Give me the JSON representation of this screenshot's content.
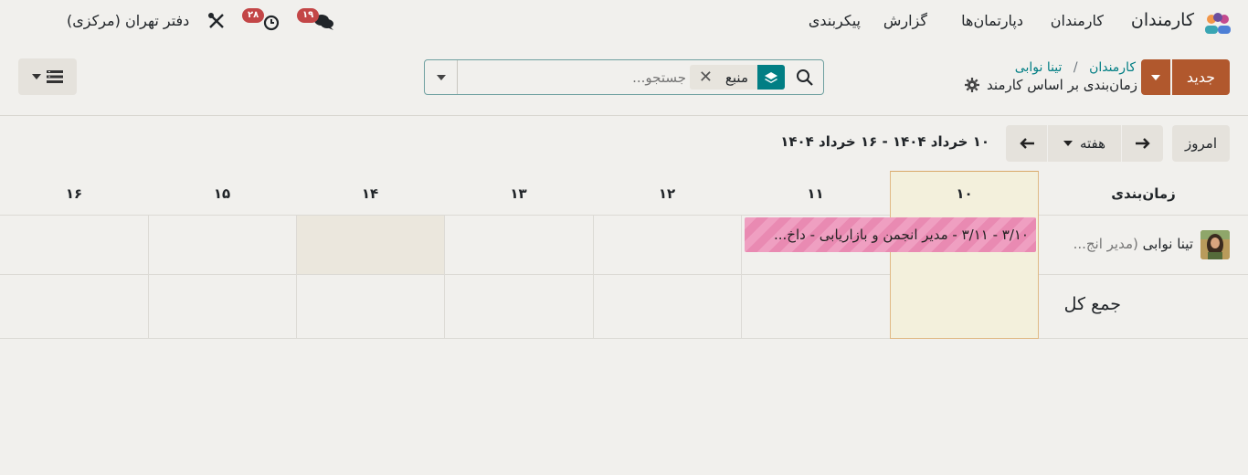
{
  "navbar": {
    "app_name": "کارمندان",
    "menu": [
      "کارمندان",
      "دپارتمان‌ها",
      "گزارش",
      "پیکربندی"
    ],
    "company": "دفتر تهران (مرکزی)",
    "messages_count": "۱۹",
    "activities_count": "۲۸"
  },
  "control_panel": {
    "new_label": "جدید",
    "breadcrumb": [
      "کارمندان",
      "تینا نوابی"
    ],
    "breadcrumb_sep": "/",
    "view_title": "زمان‌بندی بر اساس کارمند",
    "search_placeholder": "جستجو...",
    "facet_label": "منبع"
  },
  "calendar": {
    "today_label": "امروز",
    "scale_label": "هفته",
    "date_range": "۱۰ خرداد ۱۴۰۴ - ۱۶ خرداد ۱۴۰۴",
    "row_header_title": "زمان‌بندی",
    "days": [
      "۱۰",
      "۱۱",
      "۱۲",
      "۱۳",
      "۱۴",
      "۱۵",
      "۱۶"
    ],
    "rows": [
      {
        "name": "تینا نوابی",
        "subtitle": "(مدیر انج...",
        "slot_text": "۳/۱۰ - ۳/۱۱ - مدیر انجمن و بازاریابی - داخ..."
      }
    ],
    "total_label": "جمع کل"
  },
  "colors": {
    "brand": "#b1582d",
    "accent_green": "#017e84",
    "slot_pink": "#e98ab2",
    "today_col": "#f3f0dc"
  }
}
